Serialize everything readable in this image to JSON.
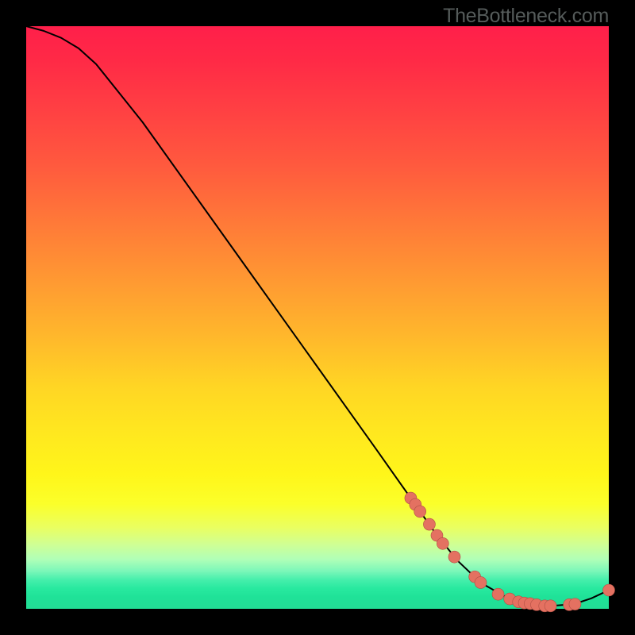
{
  "attribution": "TheBottleneck.com",
  "chart_data": {
    "type": "line",
    "title": "",
    "xlabel": "",
    "ylabel": "",
    "xlim": [
      0,
      100
    ],
    "ylim": [
      0,
      100
    ],
    "grid": false,
    "legend": false,
    "series": [
      {
        "name": "curve",
        "color": "#000000",
        "stroke_width": 2,
        "x": [
          0,
          3,
          6,
          9,
          12,
          20,
          30,
          40,
          50,
          60,
          66,
          70,
          74,
          78,
          82,
          86,
          90,
          94,
          97,
          100
        ],
        "y": [
          100,
          99.2,
          98.0,
          96.2,
          93.5,
          83.5,
          69.5,
          55.5,
          41.5,
          27.5,
          19.0,
          13.3,
          8.3,
          4.5,
          2.2,
          1.0,
          0.5,
          0.8,
          1.8,
          3.2
        ]
      }
    ],
    "markers": [
      {
        "name": "dots",
        "shape": "circle",
        "radius": 7.5,
        "fill": "#e47161",
        "stroke": "#b04f44",
        "stroke_width": 0.6,
        "points": [
          {
            "x": 66.0,
            "y": 19.0
          },
          {
            "x": 66.8,
            "y": 17.9
          },
          {
            "x": 67.6,
            "y": 16.7
          },
          {
            "x": 69.2,
            "y": 14.5
          },
          {
            "x": 70.5,
            "y": 12.6
          },
          {
            "x": 71.5,
            "y": 11.2
          },
          {
            "x": 73.5,
            "y": 8.9
          },
          {
            "x": 77.0,
            "y": 5.5
          },
          {
            "x": 78.0,
            "y": 4.5
          },
          {
            "x": 81.0,
            "y": 2.5
          },
          {
            "x": 83.0,
            "y": 1.7
          },
          {
            "x": 84.5,
            "y": 1.2
          },
          {
            "x": 85.5,
            "y": 1.0
          },
          {
            "x": 86.5,
            "y": 0.9
          },
          {
            "x": 87.6,
            "y": 0.7
          },
          {
            "x": 89.0,
            "y": 0.5
          },
          {
            "x": 90.0,
            "y": 0.5
          },
          {
            "x": 93.2,
            "y": 0.7
          },
          {
            "x": 94.2,
            "y": 0.8
          },
          {
            "x": 100.0,
            "y": 3.2
          }
        ]
      }
    ]
  }
}
